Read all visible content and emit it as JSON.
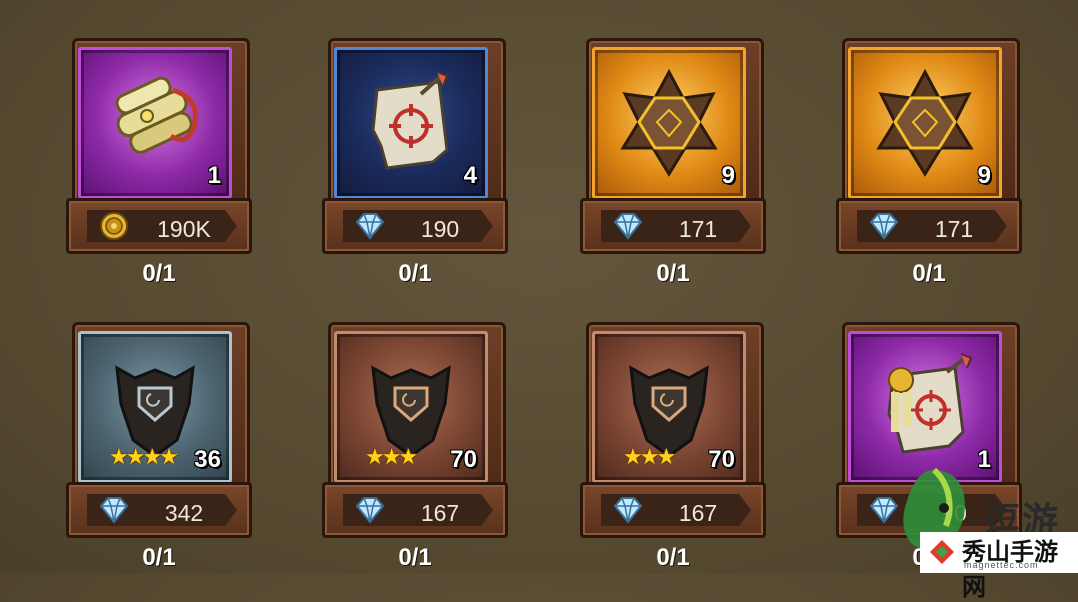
{
  "items": [
    {
      "icon": "scroll-bundle-icon",
      "rarity": "purple",
      "quantity": "1",
      "stars": "",
      "currency": "gold-coin-icon",
      "price": "190K",
      "progress": "0/1"
    },
    {
      "icon": "target-scroll-icon",
      "rarity": "blue",
      "quantity": "4",
      "stars": "",
      "currency": "diamond-icon",
      "price": "190",
      "progress": "0/1"
    },
    {
      "icon": "star-crystal-icon",
      "rarity": "orange",
      "quantity": "9",
      "stars": "",
      "currency": "diamond-icon",
      "price": "171",
      "progress": "0/1"
    },
    {
      "icon": "star-crystal-icon",
      "rarity": "orange",
      "quantity": "9",
      "stars": "",
      "currency": "diamond-icon",
      "price": "171",
      "progress": "0/1"
    },
    {
      "icon": "armor-shard-icon",
      "rarity": "silver",
      "quantity": "36",
      "stars": "★★★★",
      "currency": "diamond-icon",
      "price": "342",
      "progress": "0/1"
    },
    {
      "icon": "armor-shard-icon",
      "rarity": "brown",
      "quantity": "70",
      "stars": "★★★",
      "currency": "diamond-icon",
      "price": "167",
      "progress": "0/1"
    },
    {
      "icon": "armor-shard-icon",
      "rarity": "brown",
      "quantity": "70",
      "stars": "★★★",
      "currency": "diamond-icon",
      "price": "167",
      "progress": "0/1"
    },
    {
      "icon": "sealed-scroll-icon",
      "rarity": "purple",
      "quantity": "1",
      "stars": "",
      "currency": "diamond-icon",
      "price": "90",
      "progress": "0/1"
    }
  ],
  "watermark": {
    "text1": "逗游",
    "text2": "秀山手游网",
    "sub": "magnettec.com"
  }
}
